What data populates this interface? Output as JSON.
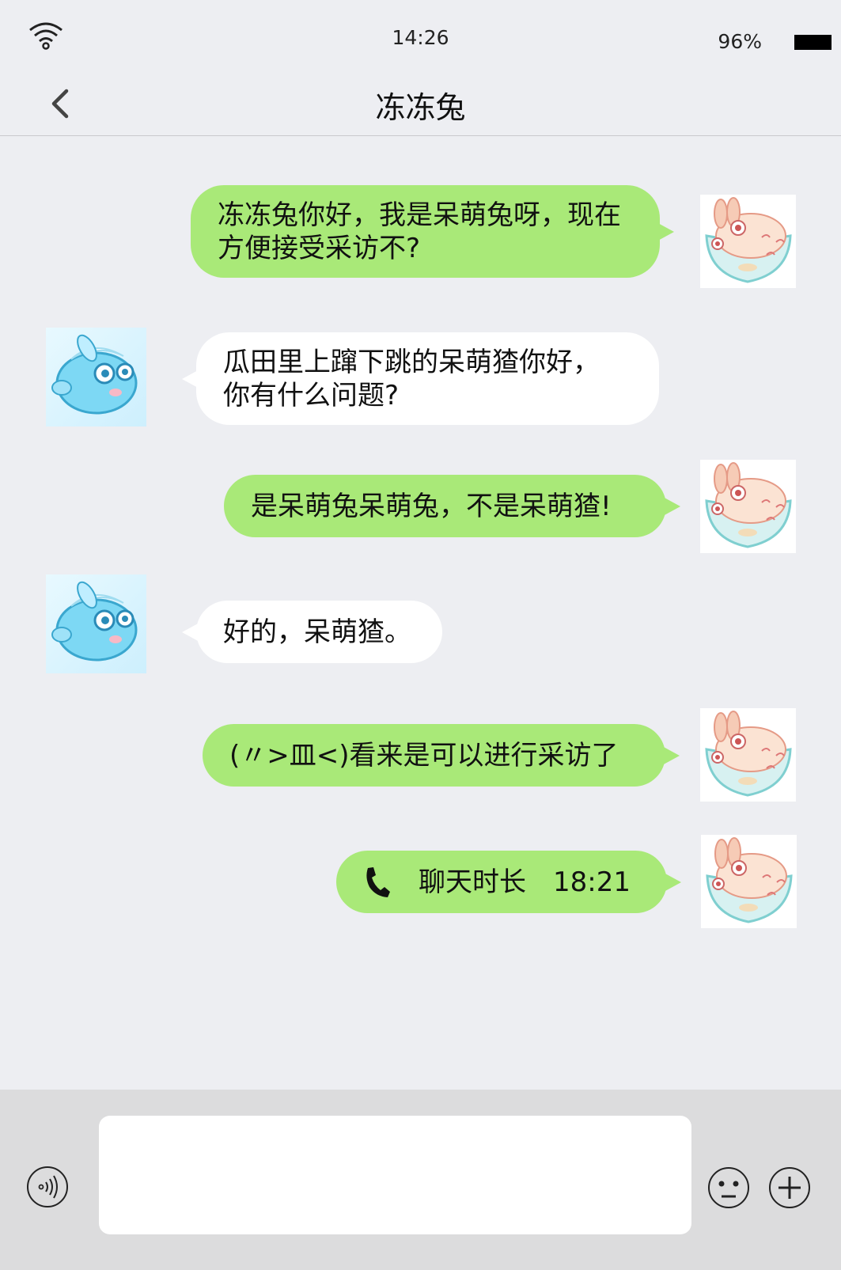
{
  "status_bar": {
    "time": "14:26",
    "battery": "96%",
    "wifi_icon": "wifi-icon",
    "battery_icon": "battery-icon"
  },
  "nav": {
    "back_icon": "chevron-left-icon",
    "title": "冻冻兔"
  },
  "messages": [
    {
      "side": "right",
      "text": "冻冻兔你好，我是呆萌兔呀，现在\n方便接受采访不?"
    },
    {
      "side": "left",
      "text": "瓜田里上蹿下跳的呆萌猹你好，\n你有什么问题?"
    },
    {
      "side": "right",
      "text": "是呆萌兔呆萌兔，不是呆萌猹!"
    },
    {
      "side": "left",
      "text": "好的，呆萌猹。"
    },
    {
      "side": "right",
      "text": "(〃>皿<)看来是可以进行采访了"
    },
    {
      "side": "right",
      "type": "call",
      "label": "聊天时长",
      "duration": "18:21",
      "icon": "phone-icon"
    }
  ],
  "input_bar": {
    "voice_icon": "voice-icon",
    "input_value": "",
    "emoji_icon": "emoji-icon",
    "plus_icon": "plus-icon"
  },
  "colors": {
    "background": "#edeef2",
    "my_bubble": "#a9e978",
    "their_bubble": "#ffffff",
    "input_bar": "#dcdcdd"
  }
}
